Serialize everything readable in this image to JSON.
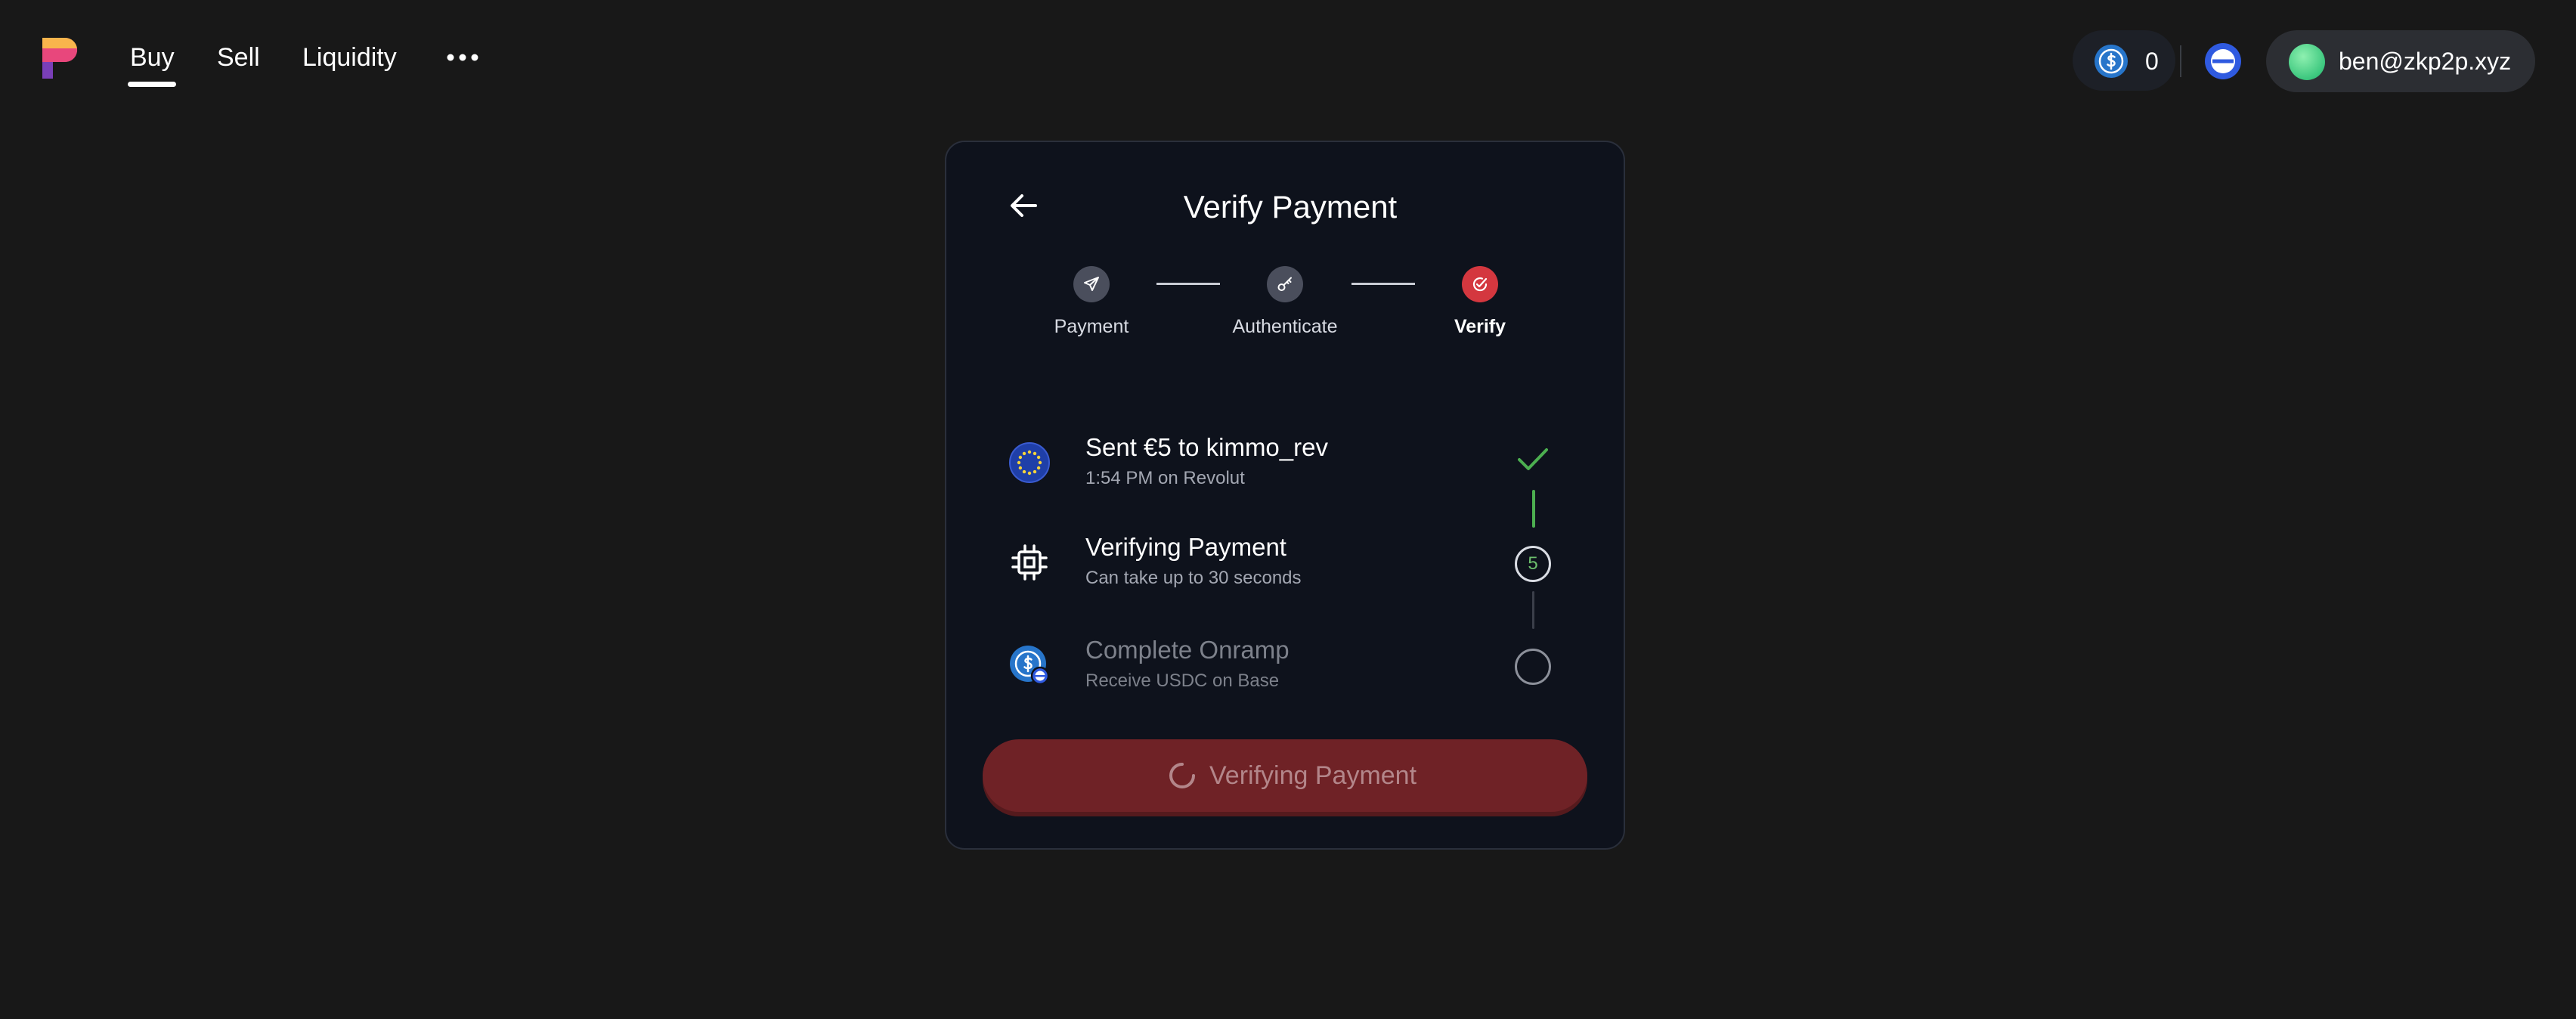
{
  "nav": {
    "items": [
      {
        "label": "Buy",
        "active": true
      },
      {
        "label": "Sell",
        "active": false
      },
      {
        "label": "Liquidity",
        "active": false
      }
    ],
    "more_icon": "ellipsis-icon"
  },
  "header": {
    "balance": "0",
    "balance_icon": "usdc-icon",
    "chain_icon": "base-chain-icon",
    "account_email": "ben@zkp2p.xyz"
  },
  "card": {
    "title": "Verify Payment",
    "back_icon": "arrow-left-icon",
    "steps": [
      {
        "label": "Payment",
        "icon": "paper-plane-icon",
        "active": false
      },
      {
        "label": "Authenticate",
        "icon": "key-icon",
        "active": false
      },
      {
        "label": "Verify",
        "icon": "check-circle-icon",
        "active": true
      }
    ],
    "rows": [
      {
        "title": "Sent €5 to kimmo_rev",
        "subtitle": "1:54 PM on Revolut",
        "status": "done"
      },
      {
        "title": "Verifying Payment",
        "subtitle": "Can take up to 30 seconds",
        "status": "in-progress",
        "countdown": "5"
      },
      {
        "title": "Complete Onramp",
        "subtitle": "Receive USDC on Base",
        "status": "pending"
      }
    ],
    "button_label": "Verifying Payment"
  },
  "colors": {
    "background": "#181818",
    "card": "#0e121c",
    "accent_red": "#d4373f",
    "button": "#6f2226",
    "success": "#4caf50"
  }
}
